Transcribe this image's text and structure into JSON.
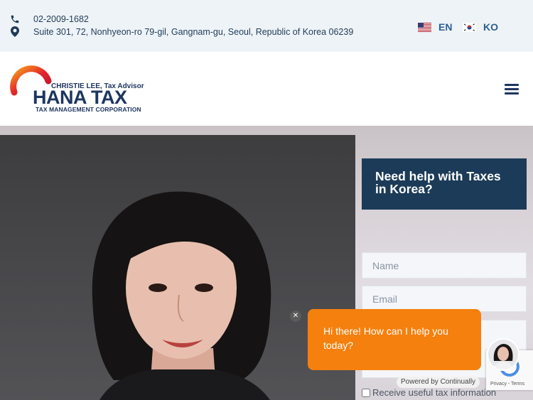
{
  "topbar": {
    "phone": "02-2009-1682",
    "address": "Suite 301, 72, Nonhyeon-ro 79-gil, Gangnam-gu, Seoul, Republic of Korea 06239",
    "languages": [
      {
        "code": "EN",
        "flag_icon": "us-flag-icon"
      },
      {
        "code": "KO",
        "flag_icon": "kr-flag-icon"
      }
    ]
  },
  "header": {
    "logo": {
      "advisor": "CHRISTIE LEE, Tax Advisor",
      "main": "HANA TAX",
      "sub": "TAX MANAGEMENT CORPORATION"
    },
    "menu_icon": "hamburger-menu-icon"
  },
  "form": {
    "heading": "Need help with Taxes in Korea?",
    "name_placeholder": "Name",
    "email_placeholder": "Email",
    "checkbox_label": "Receive useful tax information"
  },
  "chat": {
    "message": "Hi there! How can I help you today?",
    "powered_by": "Powered by Continually"
  },
  "recaptcha": {
    "text": "Privacy - Terms"
  },
  "colors": {
    "topbar_bg": "#eef3f7",
    "navy": "#1c3b58",
    "link_blue": "#2a5f93",
    "chat_orange": "#f5800e"
  }
}
